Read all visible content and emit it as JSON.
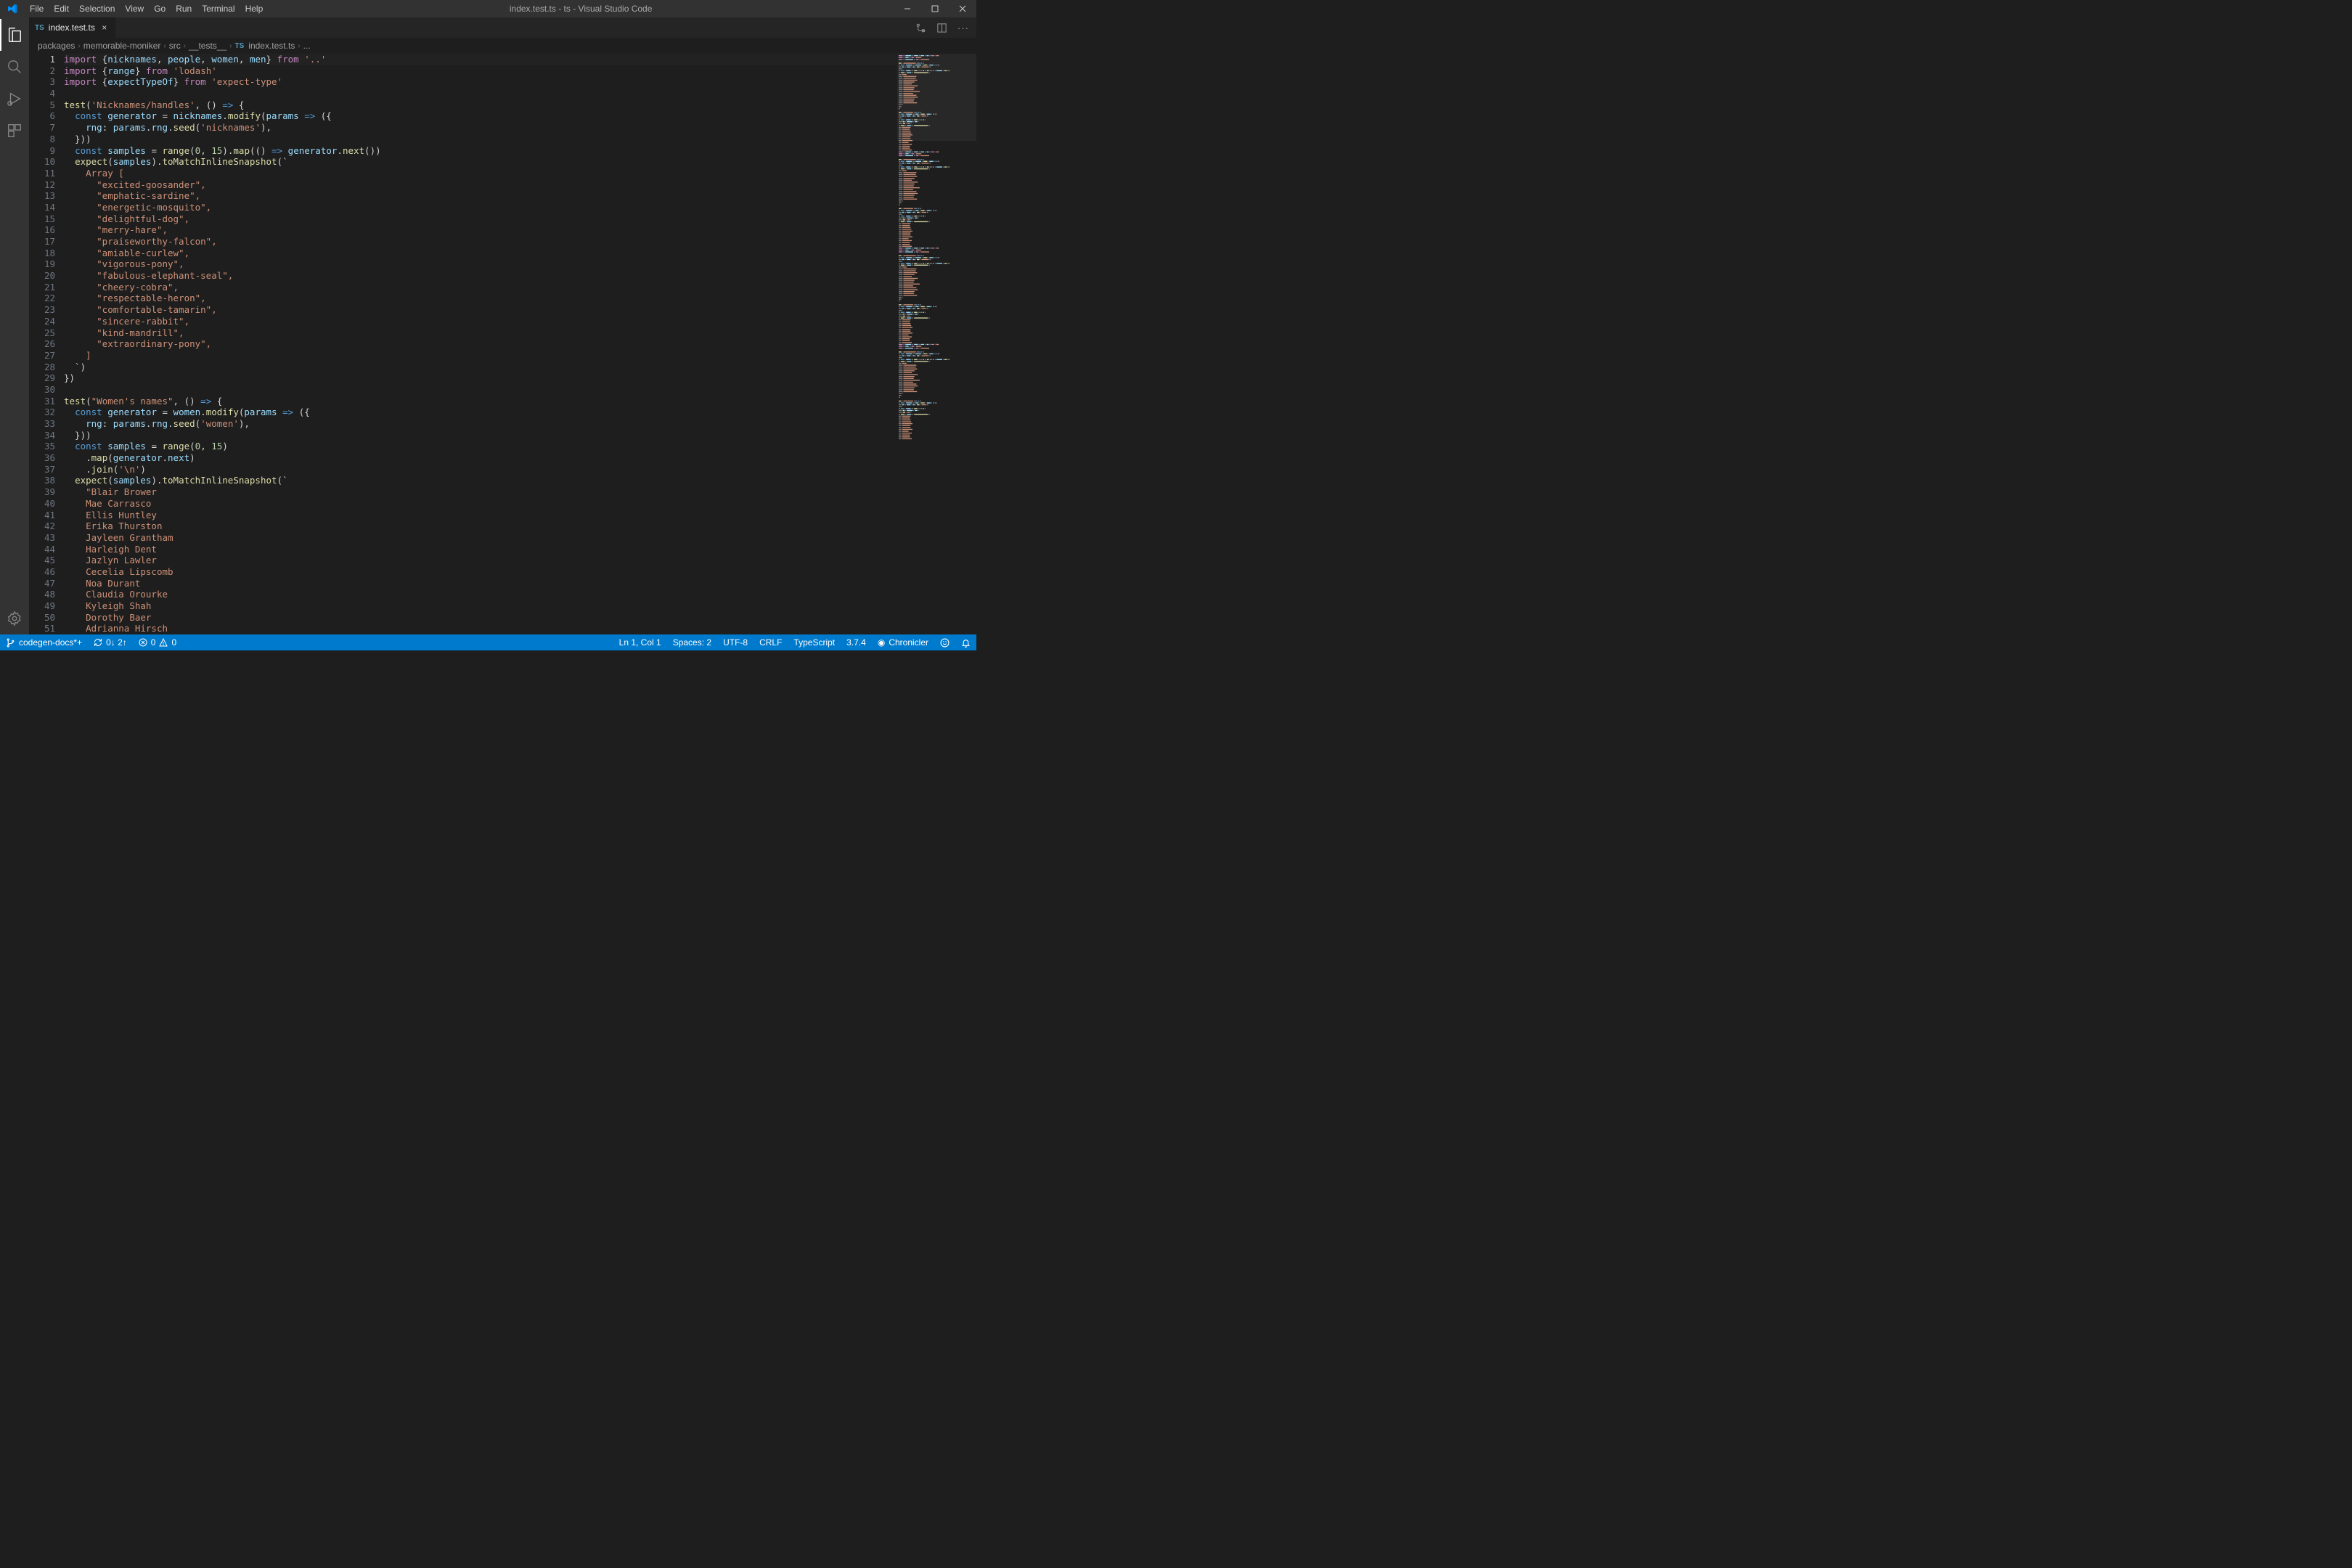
{
  "window": {
    "title": "index.test.ts - ts - Visual Studio Code"
  },
  "menu": [
    "File",
    "Edit",
    "Selection",
    "View",
    "Go",
    "Run",
    "Terminal",
    "Help"
  ],
  "tab": {
    "filename": "index.test.ts",
    "lang_badge": "TS"
  },
  "breadcrumb": {
    "parts": [
      "packages",
      "memorable-moniker",
      "src",
      "__tests__"
    ],
    "file_badge": "TS",
    "file": "index.test.ts",
    "trailing": "..."
  },
  "code_lines": [
    [
      [
        "mag",
        "import"
      ],
      [
        "pun",
        " {"
      ],
      [
        "lblue",
        "nicknames"
      ],
      [
        "pun",
        ", "
      ],
      [
        "lblue",
        "people"
      ],
      [
        "pun",
        ", "
      ],
      [
        "lblue",
        "women"
      ],
      [
        "pun",
        ", "
      ],
      [
        "lblue",
        "men"
      ],
      [
        "pun",
        "} "
      ],
      [
        "mag",
        "from"
      ],
      [
        "pun",
        " "
      ],
      [
        "str",
        "'..'"
      ]
    ],
    [
      [
        "mag",
        "import"
      ],
      [
        "pun",
        " {"
      ],
      [
        "lblue",
        "range"
      ],
      [
        "pun",
        "} "
      ],
      [
        "mag",
        "from"
      ],
      [
        "pun",
        " "
      ],
      [
        "str",
        "'lodash'"
      ]
    ],
    [
      [
        "mag",
        "import"
      ],
      [
        "pun",
        " {"
      ],
      [
        "lblue",
        "expectTypeOf"
      ],
      [
        "pun",
        "} "
      ],
      [
        "mag",
        "from"
      ],
      [
        "pun",
        " "
      ],
      [
        "str",
        "'expect-type'"
      ]
    ],
    [],
    [
      [
        "func",
        "test"
      ],
      [
        "pun",
        "("
      ],
      [
        "str",
        "'Nicknames/handles'"
      ],
      [
        "pun",
        ", () "
      ],
      [
        "blue",
        "=>"
      ],
      [
        "pun",
        " {"
      ]
    ],
    [
      [
        "pun",
        "  "
      ],
      [
        "blue",
        "const"
      ],
      [
        "pun",
        " "
      ],
      [
        "lblue",
        "generator"
      ],
      [
        "pun",
        " = "
      ],
      [
        "lblue",
        "nicknames"
      ],
      [
        "pun",
        "."
      ],
      [
        "func",
        "modify"
      ],
      [
        "pun",
        "("
      ],
      [
        "lblue",
        "params"
      ],
      [
        "pun",
        " "
      ],
      [
        "blue",
        "=>"
      ],
      [
        "pun",
        " ({"
      ]
    ],
    [
      [
        "pun",
        "    "
      ],
      [
        "lblue",
        "rng"
      ],
      [
        "pun",
        ": "
      ],
      [
        "lblue",
        "params"
      ],
      [
        "pun",
        "."
      ],
      [
        "lblue",
        "rng"
      ],
      [
        "pun",
        "."
      ],
      [
        "func",
        "seed"
      ],
      [
        "pun",
        "("
      ],
      [
        "str",
        "'nicknames'"
      ],
      [
        "pun",
        "),"
      ]
    ],
    [
      [
        "pun",
        "  }))"
      ]
    ],
    [
      [
        "pun",
        "  "
      ],
      [
        "blue",
        "const"
      ],
      [
        "pun",
        " "
      ],
      [
        "lblue",
        "samples"
      ],
      [
        "pun",
        " = "
      ],
      [
        "func",
        "range"
      ],
      [
        "pun",
        "("
      ],
      [
        "num",
        "0"
      ],
      [
        "pun",
        ", "
      ],
      [
        "num",
        "15"
      ],
      [
        "pun",
        ")."
      ],
      [
        "func",
        "map"
      ],
      [
        "pun",
        "(() "
      ],
      [
        "blue",
        "=>"
      ],
      [
        "pun",
        " "
      ],
      [
        "lblue",
        "generator"
      ],
      [
        "pun",
        "."
      ],
      [
        "func",
        "next"
      ],
      [
        "pun",
        "())"
      ]
    ],
    [
      [
        "pun",
        "  "
      ],
      [
        "func",
        "expect"
      ],
      [
        "pun",
        "("
      ],
      [
        "lblue",
        "samples"
      ],
      [
        "pun",
        ")."
      ],
      [
        "func",
        "toMatchInlineSnapshot"
      ],
      [
        "pun",
        "(`"
      ]
    ],
    [
      [
        "pun",
        "    "
      ],
      [
        "str",
        "Array ["
      ]
    ],
    [
      [
        "pun",
        "      "
      ],
      [
        "str",
        "\"excited-goosander\","
      ]
    ],
    [
      [
        "pun",
        "      "
      ],
      [
        "str",
        "\"emphatic-sardine\","
      ]
    ],
    [
      [
        "pun",
        "      "
      ],
      [
        "str",
        "\"energetic-mosquito\","
      ]
    ],
    [
      [
        "pun",
        "      "
      ],
      [
        "str",
        "\"delightful-dog\","
      ]
    ],
    [
      [
        "pun",
        "      "
      ],
      [
        "str",
        "\"merry-hare\","
      ]
    ],
    [
      [
        "pun",
        "      "
      ],
      [
        "str",
        "\"praiseworthy-falcon\","
      ]
    ],
    [
      [
        "pun",
        "      "
      ],
      [
        "str",
        "\"amiable-curlew\","
      ]
    ],
    [
      [
        "pun",
        "      "
      ],
      [
        "str",
        "\"vigorous-pony\","
      ]
    ],
    [
      [
        "pun",
        "      "
      ],
      [
        "str",
        "\"fabulous-elephant-seal\","
      ]
    ],
    [
      [
        "pun",
        "      "
      ],
      [
        "str",
        "\"cheery-cobra\","
      ]
    ],
    [
      [
        "pun",
        "      "
      ],
      [
        "str",
        "\"respectable-heron\","
      ]
    ],
    [
      [
        "pun",
        "      "
      ],
      [
        "str",
        "\"comfortable-tamarin\","
      ]
    ],
    [
      [
        "pun",
        "      "
      ],
      [
        "str",
        "\"sincere-rabbit\","
      ]
    ],
    [
      [
        "pun",
        "      "
      ],
      [
        "str",
        "\"kind-mandrill\","
      ]
    ],
    [
      [
        "pun",
        "      "
      ],
      [
        "str",
        "\"extraordinary-pony\","
      ]
    ],
    [
      [
        "pun",
        "    "
      ],
      [
        "str",
        "]"
      ]
    ],
    [
      [
        "pun",
        "  `)"
      ]
    ],
    [
      [
        "pun",
        "})"
      ]
    ],
    [],
    [
      [
        "func",
        "test"
      ],
      [
        "pun",
        "("
      ],
      [
        "str",
        "\"Women's names\""
      ],
      [
        "pun",
        ", () "
      ],
      [
        "blue",
        "=>"
      ],
      [
        "pun",
        " {"
      ]
    ],
    [
      [
        "pun",
        "  "
      ],
      [
        "blue",
        "const"
      ],
      [
        "pun",
        " "
      ],
      [
        "lblue",
        "generator"
      ],
      [
        "pun",
        " = "
      ],
      [
        "lblue",
        "women"
      ],
      [
        "pun",
        "."
      ],
      [
        "func",
        "modify"
      ],
      [
        "pun",
        "("
      ],
      [
        "lblue",
        "params"
      ],
      [
        "pun",
        " "
      ],
      [
        "blue",
        "=>"
      ],
      [
        "pun",
        " ({"
      ]
    ],
    [
      [
        "pun",
        "    "
      ],
      [
        "lblue",
        "rng"
      ],
      [
        "pun",
        ": "
      ],
      [
        "lblue",
        "params"
      ],
      [
        "pun",
        "."
      ],
      [
        "lblue",
        "rng"
      ],
      [
        "pun",
        "."
      ],
      [
        "func",
        "seed"
      ],
      [
        "pun",
        "("
      ],
      [
        "str",
        "'women'"
      ],
      [
        "pun",
        "),"
      ]
    ],
    [
      [
        "pun",
        "  }))"
      ]
    ],
    [
      [
        "pun",
        "  "
      ],
      [
        "blue",
        "const"
      ],
      [
        "pun",
        " "
      ],
      [
        "lblue",
        "samples"
      ],
      [
        "pun",
        " = "
      ],
      [
        "func",
        "range"
      ],
      [
        "pun",
        "("
      ],
      [
        "num",
        "0"
      ],
      [
        "pun",
        ", "
      ],
      [
        "num",
        "15"
      ],
      [
        "pun",
        ")"
      ]
    ],
    [
      [
        "pun",
        "    ."
      ],
      [
        "func",
        "map"
      ],
      [
        "pun",
        "("
      ],
      [
        "lblue",
        "generator"
      ],
      [
        "pun",
        "."
      ],
      [
        "lblue",
        "next"
      ],
      [
        "pun",
        ")"
      ]
    ],
    [
      [
        "pun",
        "    ."
      ],
      [
        "func",
        "join"
      ],
      [
        "pun",
        "("
      ],
      [
        "str",
        "'\\n'"
      ],
      [
        "pun",
        ")"
      ]
    ],
    [
      [
        "pun",
        "  "
      ],
      [
        "func",
        "expect"
      ],
      [
        "pun",
        "("
      ],
      [
        "lblue",
        "samples"
      ],
      [
        "pun",
        ")."
      ],
      [
        "func",
        "toMatchInlineSnapshot"
      ],
      [
        "pun",
        "(`"
      ]
    ],
    [
      [
        "pun",
        "    "
      ],
      [
        "str",
        "\"Blair Brower"
      ]
    ],
    [
      [
        "pun",
        "    "
      ],
      [
        "str",
        "Mae Carrasco"
      ]
    ],
    [
      [
        "pun",
        "    "
      ],
      [
        "str",
        "Ellis Huntley"
      ]
    ],
    [
      [
        "pun",
        "    "
      ],
      [
        "str",
        "Erika Thurston"
      ]
    ],
    [
      [
        "pun",
        "    "
      ],
      [
        "str",
        "Jayleen Grantham"
      ]
    ],
    [
      [
        "pun",
        "    "
      ],
      [
        "str",
        "Harleigh Dent"
      ]
    ],
    [
      [
        "pun",
        "    "
      ],
      [
        "str",
        "Jazlyn Lawler"
      ]
    ],
    [
      [
        "pun",
        "    "
      ],
      [
        "str",
        "Cecelia Lipscomb"
      ]
    ],
    [
      [
        "pun",
        "    "
      ],
      [
        "str",
        "Noa Durant"
      ]
    ],
    [
      [
        "pun",
        "    "
      ],
      [
        "str",
        "Claudia Orourke"
      ]
    ],
    [
      [
        "pun",
        "    "
      ],
      [
        "str",
        "Kyleigh Shah"
      ]
    ],
    [
      [
        "pun",
        "    "
      ],
      [
        "str",
        "Dorothy Baer"
      ]
    ],
    [
      [
        "pun",
        "    "
      ],
      [
        "str",
        "Adrianna Hirsch"
      ]
    ]
  ],
  "status": {
    "branch_icon": "⎇",
    "branch": "codegen-docs*+",
    "sync": "0↓ 2↑",
    "errors": "0",
    "warnings": "0",
    "cursor": "Ln 1, Col 1",
    "spaces": "Spaces: 2",
    "encoding": "UTF-8",
    "eol": "CRLF",
    "language": "TypeScript",
    "version": "3.7.4",
    "chronicler": "Chronicler"
  }
}
